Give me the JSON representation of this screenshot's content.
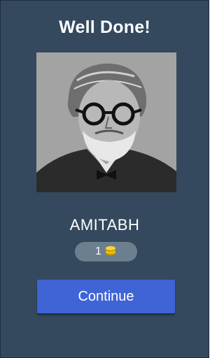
{
  "header": {
    "title": "Well Done!"
  },
  "result": {
    "answer": "AMITABH"
  },
  "reward": {
    "coins": "1",
    "icon": "coin-stack-icon",
    "coin_color": "#f2c200"
  },
  "actions": {
    "continue_label": "Continue"
  },
  "colors": {
    "background": "#34495e",
    "button": "#3f64d6",
    "badge": "#6b7f8f"
  }
}
